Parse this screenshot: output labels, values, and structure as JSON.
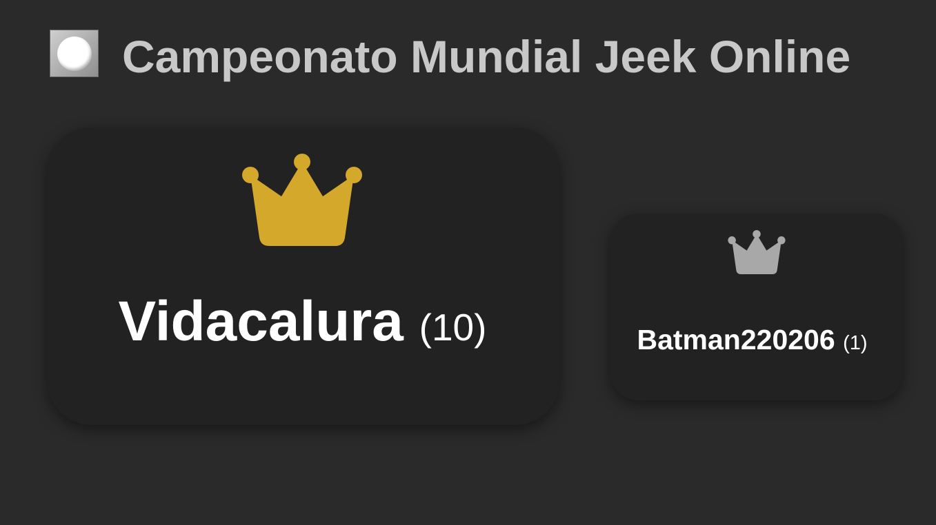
{
  "header": {
    "title": "Campeonato Mundial Jeek Online"
  },
  "ranking": [
    {
      "rank": 1,
      "name": "Vidacalura",
      "score": "(10)",
      "crown_icon": "crown-gold-icon",
      "crown_color": "#d4a82a"
    },
    {
      "rank": 2,
      "name": "Batman220206",
      "score": "(1)",
      "crown_icon": "crown-silver-icon",
      "crown_color": "#a8a8a8"
    }
  ],
  "colors": {
    "background": "#2a2a2a",
    "card": "#222222",
    "title": "#c8c8c8",
    "player_text": "#ffffff"
  }
}
